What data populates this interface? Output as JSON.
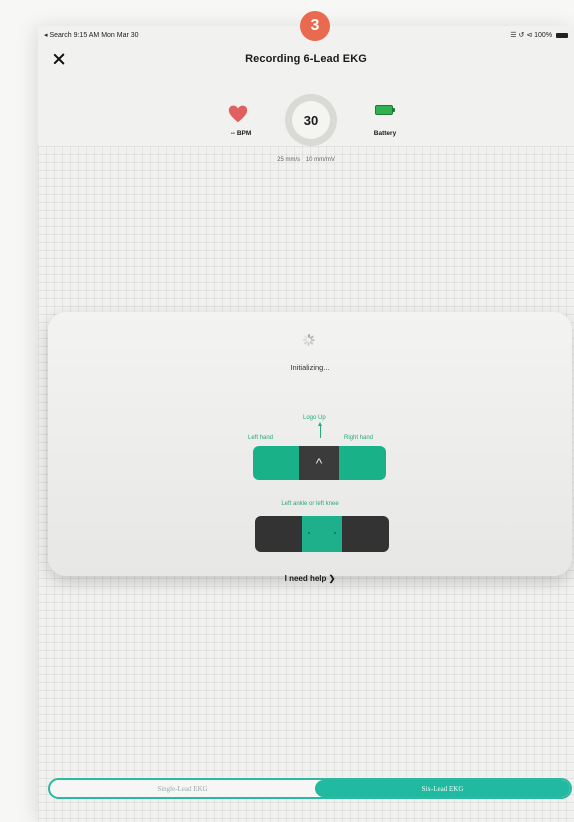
{
  "status_bar": {
    "left": "◂ Search  9:15 AM  Mon Mar 30",
    "right": "☰ ↺ ⊲ 100%"
  },
  "step_badge": "3",
  "header": {
    "title": "Recording 6-Lead EKG",
    "close_icon": "close-icon"
  },
  "stats": {
    "bpm_label": "-- BPM",
    "timer_value": "30",
    "scale_speed": "25 mm/s",
    "scale_gain": "10 mm/mV",
    "battery_label": "Battery"
  },
  "card": {
    "status": "Initializing...",
    "logo_up": "Logo Up",
    "left_hand": "Left hand",
    "right_hand": "Right hand",
    "ankle": "Left ankle or left knee",
    "help": "I need help"
  },
  "segmented": {
    "option1": "Single-Lead EKG",
    "option2": "Six-Lead EKG",
    "selected": "Six-Lead EKG"
  },
  "colors": {
    "accent": "#22b9a1",
    "heart": "#e06060",
    "badge": "#e96a4f",
    "battery": "#30b04f"
  }
}
